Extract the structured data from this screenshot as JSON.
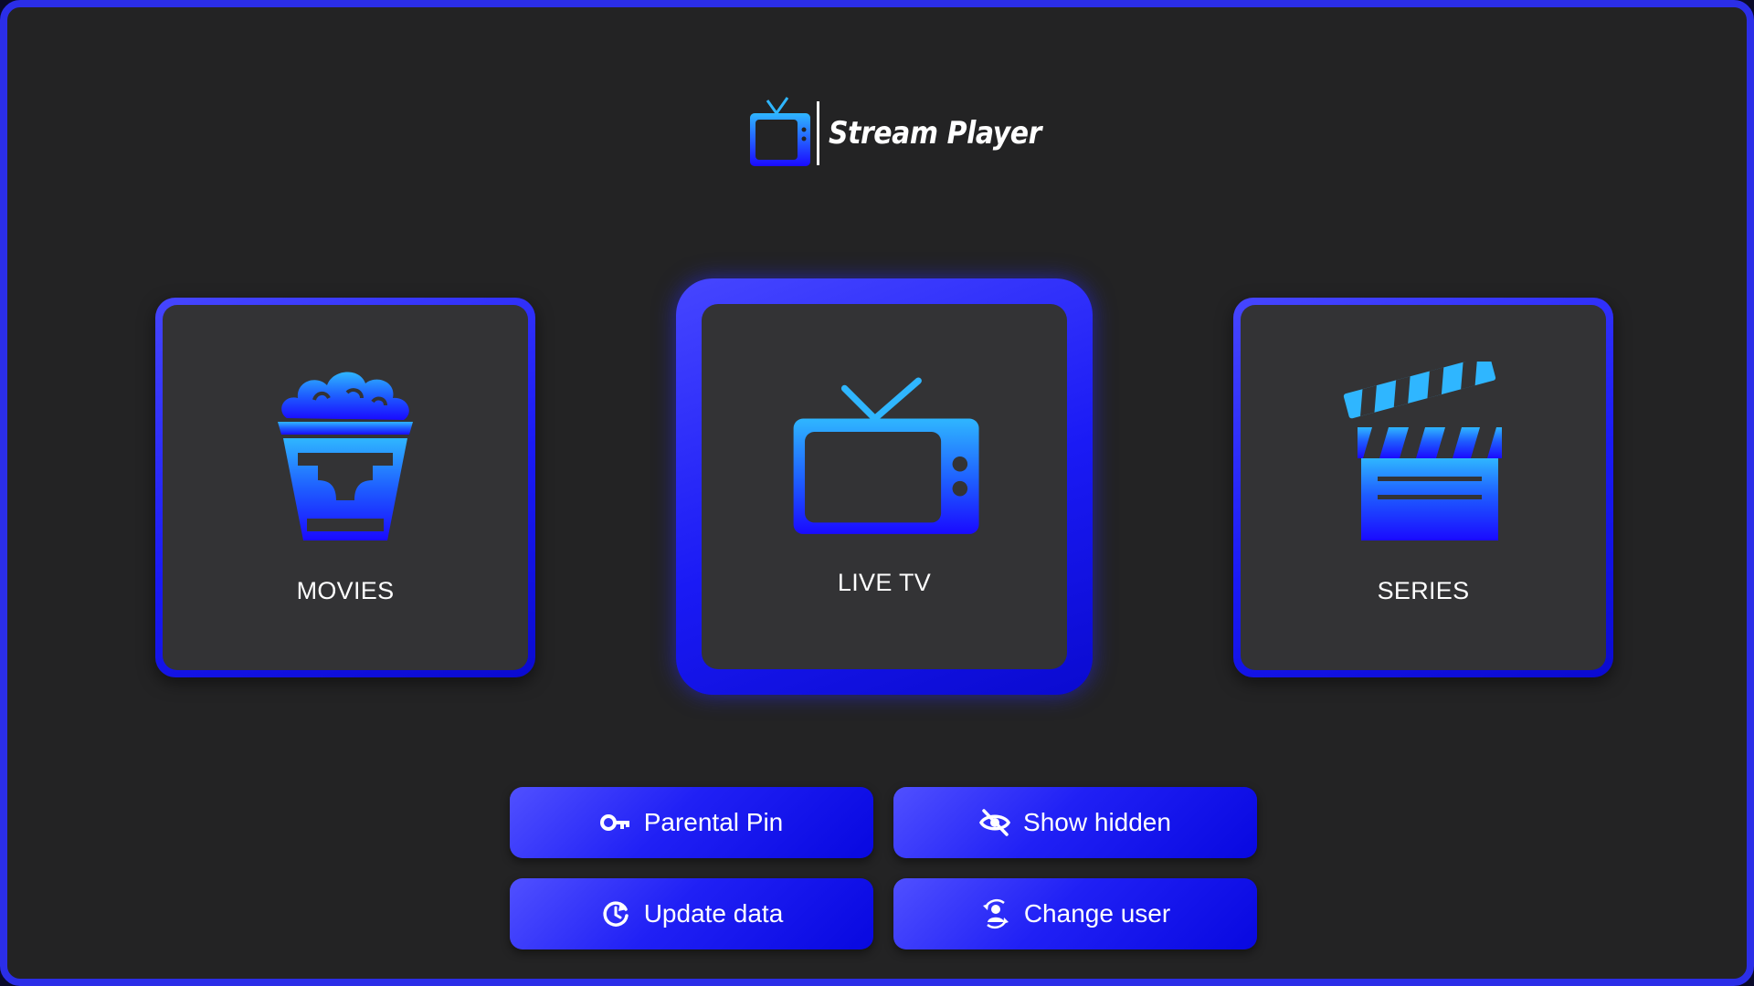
{
  "app": {
    "title": "Stream Player",
    "logo_icon": "tv-icon"
  },
  "colors": {
    "accent": "#2020f5",
    "accent_light": "#4646ff",
    "background": "#232324",
    "tile_inner": "#333335",
    "icon_gradient_top": "#2fb6ff",
    "icon_gradient_bottom": "#1a0aff"
  },
  "categories": [
    {
      "label": "MOVIES",
      "icon": "popcorn-icon",
      "focused": false
    },
    {
      "label": "LIVE TV",
      "icon": "tv-icon",
      "focused": true
    },
    {
      "label": "SERIES",
      "icon": "clapperboard-icon",
      "focused": false
    }
  ],
  "actions": [
    {
      "label": "Parental Pin",
      "icon": "key-icon"
    },
    {
      "label": "Show hidden",
      "icon": "eye-off-icon"
    },
    {
      "label": "Update data",
      "icon": "refresh-icon"
    },
    {
      "label": "Change user",
      "icon": "switch-user-icon"
    }
  ]
}
